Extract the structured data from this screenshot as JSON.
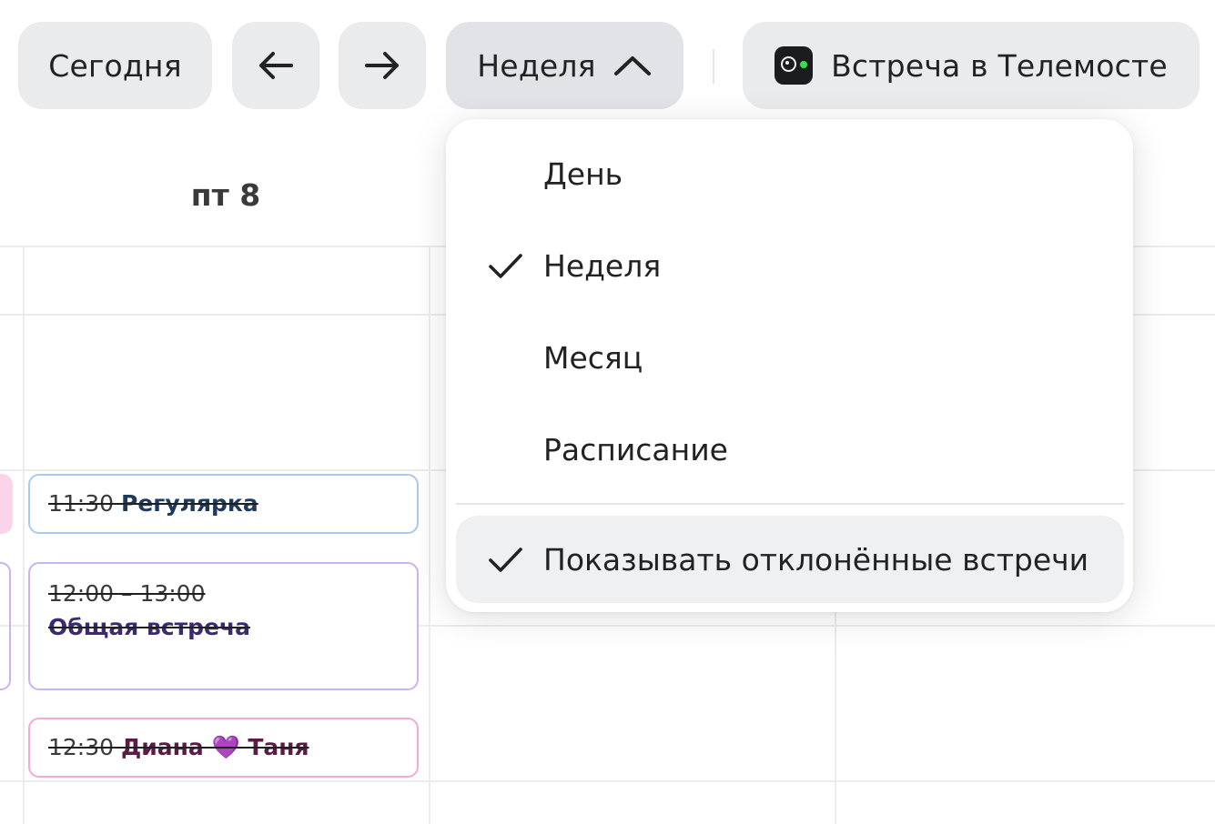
{
  "toolbar": {
    "today_label": "Сегодня",
    "prev_icon": "arrow-left-icon",
    "next_icon": "arrow-right-icon",
    "view_label": "Неделя",
    "view_icon": "chevron-up-icon",
    "telemost_label": "Встреча в Телемосте",
    "telemost_icon": "telemost-logo-icon"
  },
  "calendar": {
    "day_header": "пт 8",
    "events": [
      {
        "time": "11:30",
        "title": "Регулярка",
        "color": "#a9c9ee"
      },
      {
        "time": "12:00 – 13:00",
        "title": "Общая встреча",
        "color": "#c9b4ee"
      },
      {
        "time": "12:30",
        "title": "Диана 💜 Таня",
        "color": "#f3a9d6"
      }
    ]
  },
  "dropdown": {
    "items": [
      {
        "label": "День",
        "checked": false
      },
      {
        "label": "Неделя",
        "checked": true
      },
      {
        "label": "Месяц",
        "checked": false
      },
      {
        "label": "Расписание",
        "checked": false
      }
    ],
    "toggle": {
      "label": "Показывать отклонённые встречи",
      "checked": true
    }
  },
  "colors": {
    "button_bg": "#eaebed",
    "telemost_dot": "#35e04a"
  }
}
